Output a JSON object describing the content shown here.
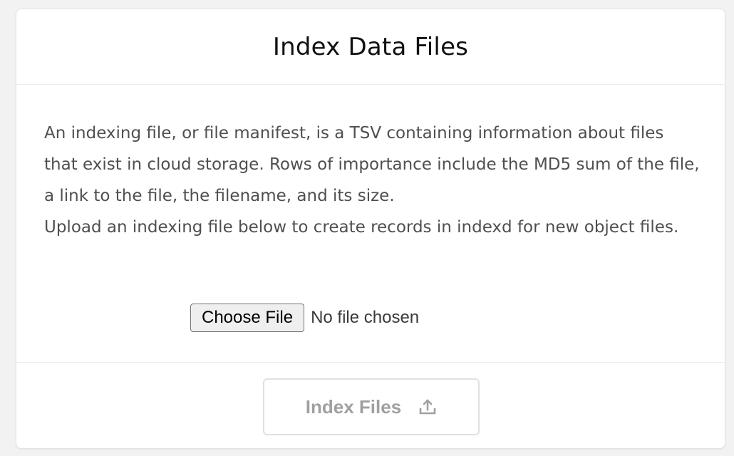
{
  "card": {
    "title": "Index Data Files",
    "description": [
      "An indexing file, or file manifest, is a TSV containing information about files that exist in cloud storage. Rows of importance include the MD5 sum of the file, a link to the file, the filename, and its size.",
      "Upload an indexing file below to create records in indexd for new object files."
    ],
    "file_input": {
      "button_label": "Choose File",
      "status": "No file chosen"
    },
    "submit": {
      "label": "Index Files",
      "icon": "upload-icon",
      "disabled": true
    }
  },
  "colors": {
    "title_text": "#111111",
    "body_text": "#4f4f4f",
    "disabled_button_text": "#a0a0a0",
    "border": "#e0e0e0",
    "page_background": "#f2f2f2"
  }
}
